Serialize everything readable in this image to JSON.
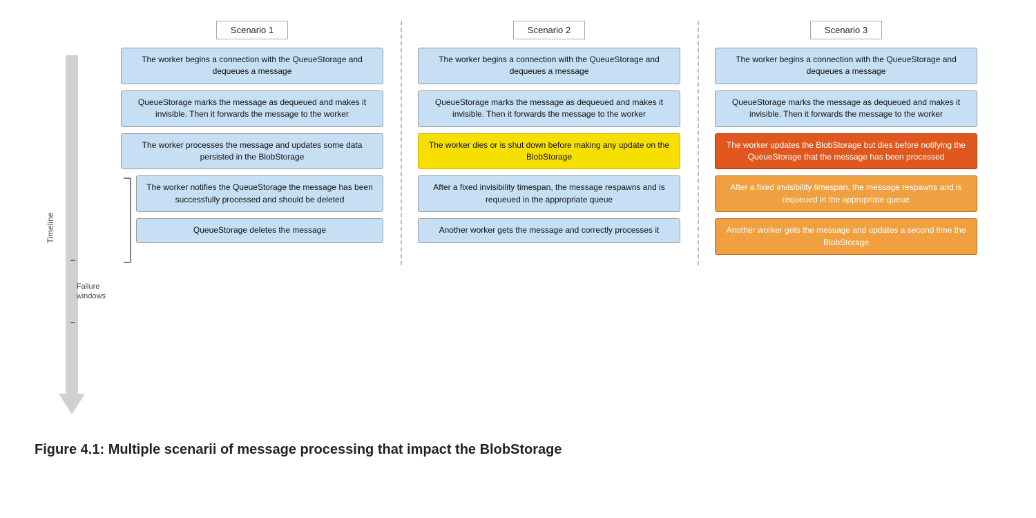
{
  "title": "Figure 4.1: Multiple scenarii of message processing that impact the BlobStorage",
  "timeline_label": "Timeline",
  "failure_label": "Failure\nwindows",
  "scenarios": [
    {
      "id": "scenario1",
      "title": "Scenario 1",
      "steps": [
        {
          "text": "The worker begins a connection with the QueueStorage and dequeues a message",
          "style": "box-blue"
        },
        {
          "text": "QueueStorage marks the message as dequeued and makes it invisible. Then it forwards the message to the worker",
          "style": "box-blue"
        },
        {
          "text": "The worker processes the message and updates some data persisted in the BlobStorage",
          "style": "box-blue"
        }
      ],
      "failure_steps": [
        {
          "text": "The worker notifies the QueueStorage the message has been successfully processed and should be deleted",
          "style": "bracket-box"
        },
        {
          "text": "QueueStorage deletes the message",
          "style": "bracket-box"
        }
      ]
    },
    {
      "id": "scenario2",
      "title": "Scenario 2",
      "steps": [
        {
          "text": "The worker begins a connection with the QueueStorage and dequeues a message",
          "style": "box-blue"
        },
        {
          "text": "QueueStorage marks the message as dequeued and makes it invisible. Then it forwards the message to the worker",
          "style": "box-blue"
        },
        {
          "text": "The worker dies or is shut down before making any update on the BlobStorage",
          "style": "box-yellow"
        },
        {
          "text": "After a fixed invisibility timespan, the message respawns and is requeued in the appropriate queue",
          "style": "box-blue"
        },
        {
          "text": "Another worker gets the message and correctly processes it",
          "style": "box-blue"
        }
      ]
    },
    {
      "id": "scenario3",
      "title": "Scenario 3",
      "steps": [
        {
          "text": "The worker begins a connection with the QueueStorage and dequeues a message",
          "style": "box-blue"
        },
        {
          "text": "QueueStorage marks the message as dequeued and makes it invisible. Then it forwards the message to the worker",
          "style": "box-blue"
        },
        {
          "text": "The worker updates the BlobStorage but dies before notifying the QueueStorage that the message has been processed",
          "style": "box-red-orange"
        },
        {
          "text": "After a fixed invisibility timespan, the message respawns and is requeued in the appropriate queue",
          "style": "box-orange"
        },
        {
          "text": "Another worker gets the message and updates a second time the BlobStorage",
          "style": "box-orange"
        }
      ]
    }
  ]
}
